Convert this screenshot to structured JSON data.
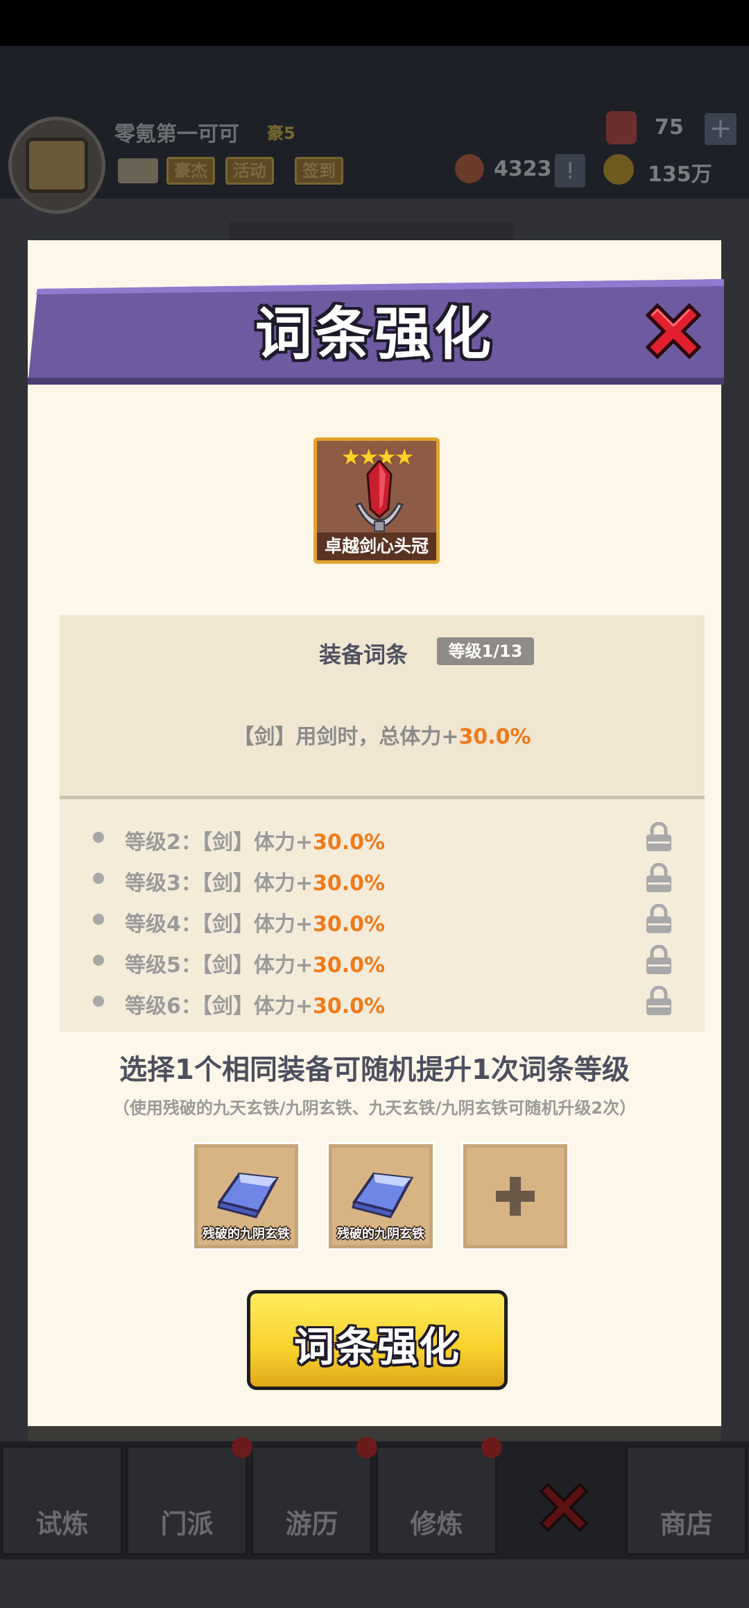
{
  "background": {
    "player_name": "零氪第一可可",
    "player_rank": "豪5",
    "buttons": [
      "豪杰",
      "活动",
      "签到"
    ],
    "gems": "75",
    "coins_left": "4323",
    "gold": "135万",
    "nav": [
      {
        "label": "试炼"
      },
      {
        "label": "门派"
      },
      {
        "label": "游历"
      },
      {
        "label": "修炼"
      },
      {
        "label": ""
      },
      {
        "label": "商店"
      }
    ]
  },
  "modal": {
    "title": "词条强化",
    "item": {
      "name": "卓越剑心头冠",
      "stars": "★★★★"
    },
    "affix": {
      "title": "装备词条",
      "level": "等级1/13",
      "current_prefix": "【剑】用剑时，总体力+",
      "current_value": "30.0%"
    },
    "levels": [
      {
        "label": "等级2：【剑】体力+",
        "value": "30.0%"
      },
      {
        "label": "等级3：【剑】体力+",
        "value": "30.0%"
      },
      {
        "label": "等级4：【剑】体力+",
        "value": "30.0%"
      },
      {
        "label": "等级5：【剑】体力+",
        "value": "30.0%"
      },
      {
        "label": "等级6：【剑】体力+",
        "value": "30.0%"
      }
    ],
    "tip_main": "选择1个相同装备可随机提升1次词条等级",
    "tip_sub": "（使用残破的九天玄铁/九阴玄铁、九天玄铁/九阴玄铁可随机升级2次）",
    "materials": [
      {
        "label": "残破的九阴玄铁"
      },
      {
        "label": "残破的九阴玄铁"
      }
    ],
    "action_label": "词条强化"
  }
}
